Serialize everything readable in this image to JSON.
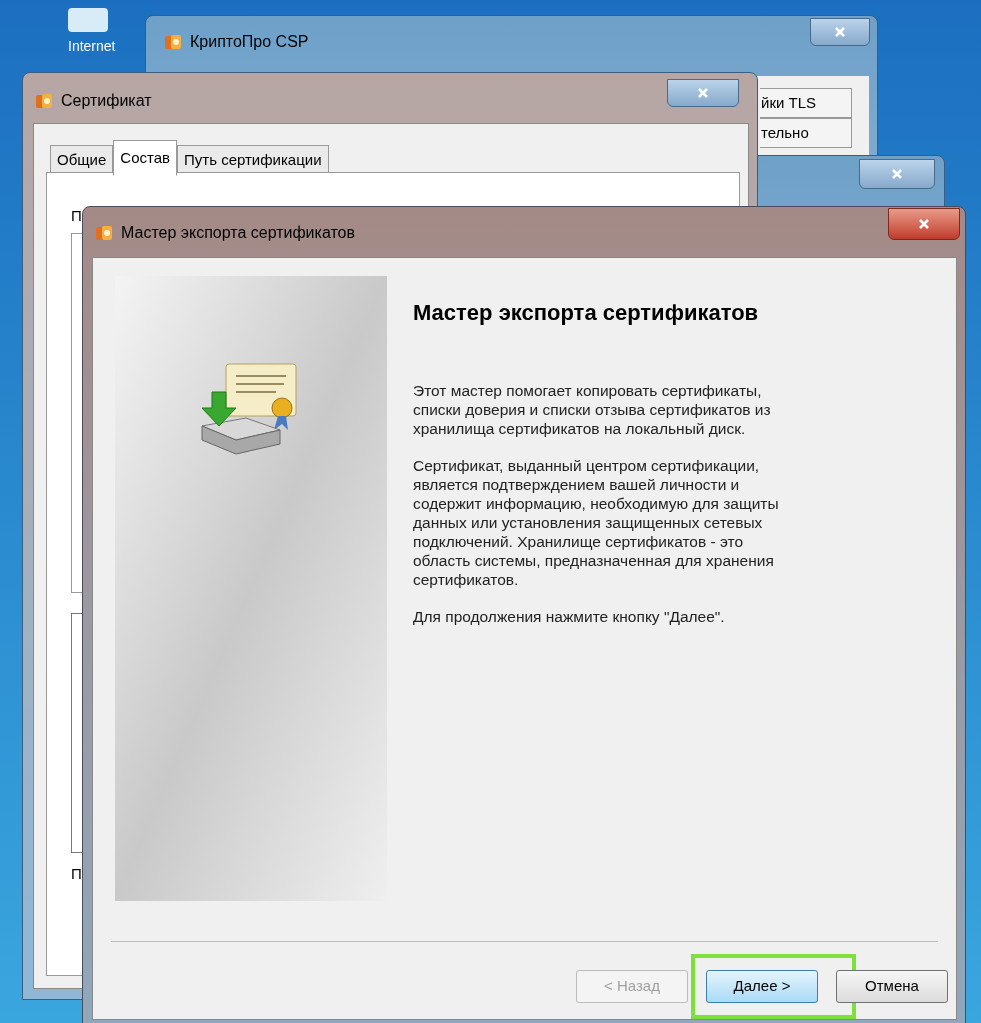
{
  "desktop": {
    "icon_label": "Internet"
  },
  "cryptopro_window": {
    "title": "КриптоПро CSP",
    "tabs": [
      {
        "label": "йки TLS"
      },
      {
        "label": "тельно"
      }
    ]
  },
  "certificate_window": {
    "title": "Сертификат",
    "tabs": [
      {
        "label": "Общие",
        "selected": false
      },
      {
        "label": "Состав",
        "selected": true
      },
      {
        "label": "Путь сертификации",
        "selected": false
      }
    ],
    "labels": [
      "П",
      "П"
    ]
  },
  "wizard": {
    "title": "Мастер экспорта сертификатов",
    "heading": "Мастер экспорта сертификатов",
    "paragraphs": [
      "Этот мастер помогает копировать сертификаты, списки доверия и списки отзыва сертификатов из хранилища сертификатов на локальный диск.",
      "Сертификат, выданный центром сертификации, является подтверждением вашей личности и содержит информацию, необходимую для защиты данных или установления защищенных сетевых подключений. Хранилище сертификатов - это область системы, предназначенная для хранения сертификатов.",
      "Для продолжения нажмите кнопку \"Далее\"."
    ],
    "buttons": [
      {
        "label": "< Назад",
        "disabled": true,
        "highlighted": false,
        "default": false
      },
      {
        "label": "Далее >",
        "disabled": false,
        "highlighted": true,
        "default": true
      },
      {
        "label": "Отмена",
        "disabled": false,
        "highlighted": false,
        "default": false
      }
    ]
  }
}
